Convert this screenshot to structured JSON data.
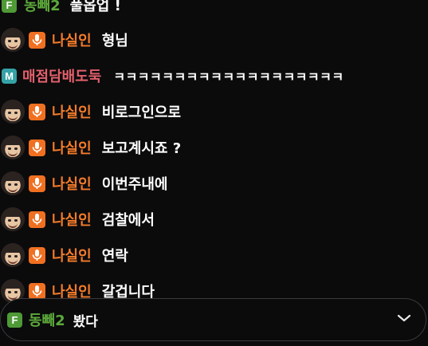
{
  "messages": [
    {
      "type": "fan",
      "badge": "F",
      "nick": "동빼2",
      "text": "풀옵업 !",
      "nick_color": "#5caa3b"
    },
    {
      "type": "host",
      "nick": "나실인",
      "text": "형님"
    },
    {
      "type": "manager",
      "badge": "M",
      "nick": "매점담배도둑",
      "text": "ㅋㅋㅋㅋㅋㅋㅋㅋㅋㅋㅋㅋㅋㅋㅋㅋㅋㅋㅋ"
    },
    {
      "type": "host",
      "nick": "나실인",
      "text": "비로그인으로"
    },
    {
      "type": "host",
      "nick": "나실인",
      "text": "보고계시죠 ?"
    },
    {
      "type": "host",
      "nick": "나실인",
      "text": "이번주내에"
    },
    {
      "type": "host",
      "nick": "나실인",
      "text": "검찰에서"
    },
    {
      "type": "host",
      "nick": "나실인",
      "text": "연락"
    },
    {
      "type": "host",
      "nick": "나실인",
      "text": "갈겁니다"
    }
  ],
  "pinned": {
    "badge": "F",
    "nick": "동빼2",
    "text": "봤다",
    "chevron_icon": "chevron-down-icon"
  },
  "colors": {
    "host": "#f47b2a",
    "fan": "#5caa3b",
    "manager": "#e3606b",
    "mic_badge": "#f07021",
    "background": "#0b0b0c"
  }
}
